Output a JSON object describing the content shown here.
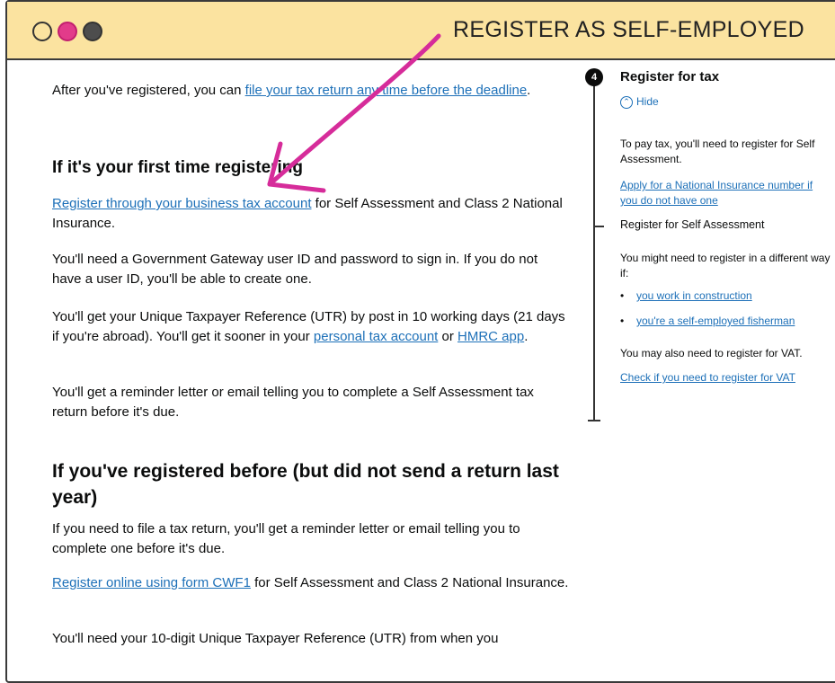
{
  "window": {
    "title": "REGISTER AS SELF-EMPLOYED",
    "colors": {
      "titlebar": "#fbe3a0",
      "dot_pink": "#e23b8a",
      "dot_dark": "#4d4d4d",
      "link": "#1d70b8",
      "annotation": "#d62c9a"
    }
  },
  "main": {
    "intro": {
      "before": "After you've registered, you can ",
      "link": "file your tax return any time before the deadline",
      "after": "."
    },
    "section1": {
      "heading": "If it's your first time registering",
      "p1": {
        "link": "Register through your business tax account",
        "after": " for Self Assessment and Class 2 National Insurance."
      },
      "p2": "You'll need a Government Gateway user ID and password to sign in. If you do not have a user ID, you'll be able to create one.",
      "p3": {
        "before": "You'll get your Unique Taxpayer Reference (UTR) by post in 10 working days (21 days if you're abroad). You'll get it sooner in your ",
        "link1": "personal tax account",
        "mid": " or ",
        "link2": "HMRC app",
        "after": "."
      },
      "p4": "You'll get a reminder letter or email telling you to complete a Self Assessment tax return before it's due."
    },
    "section2": {
      "heading": "If you've registered before (but did not send a return last year)",
      "p1": "If you need to file a tax return, you'll get a reminder letter or email telling you to complete one before it's due.",
      "p2": {
        "link": "Register online using form CWF1",
        "after": " for Self Assessment and Class 2 National Insurance."
      },
      "p3": "You'll need your 10-digit Unique Taxpayer Reference (UTR) from when you"
    }
  },
  "sidebar": {
    "step_number": "4",
    "title": "Register for tax",
    "hide_label": "Hide",
    "intro": "To pay tax, you'll need to register for Self Assessment.",
    "link_ni": "Apply for a National Insurance number if you do not have one",
    "current": "Register for Self Assessment",
    "might_need": "You might need to register in a different way if:",
    "bullets": [
      "you work in construction",
      "you're a self-employed fisherman"
    ],
    "vat_text": "You may also need to register for VAT.",
    "vat_link": "Check if you need to register for VAT"
  }
}
